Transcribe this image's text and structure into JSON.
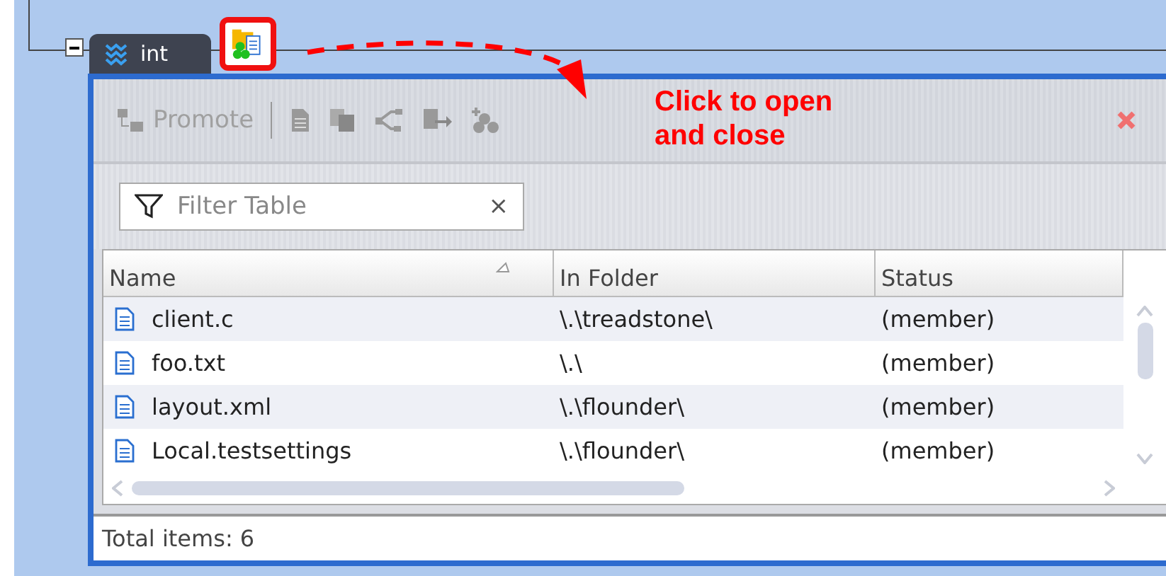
{
  "tree_node": {
    "label": "int",
    "expanded": true
  },
  "toolbar": {
    "promote_label": "Promote"
  },
  "annotation": {
    "text": "Click to open and close"
  },
  "filter": {
    "placeholder": "Filter Table",
    "clear": "×"
  },
  "table": {
    "columns": [
      {
        "label": "Name",
        "sorted": true
      },
      {
        "label": "In Folder",
        "sorted": false
      },
      {
        "label": "Status",
        "sorted": false
      }
    ],
    "rows": [
      {
        "name": "client.c",
        "folder": "\\.\\treadstone\\",
        "status": "(member)"
      },
      {
        "name": "foo.txt",
        "folder": "\\.\\",
        "status": "(member)"
      },
      {
        "name": "layout.xml",
        "folder": "\\.\\flounder\\",
        "status": "(member)"
      },
      {
        "name": "Local.testsettings",
        "folder": "\\.\\flounder\\",
        "status": "(member)"
      }
    ]
  },
  "status_bar": "Total items: 6"
}
